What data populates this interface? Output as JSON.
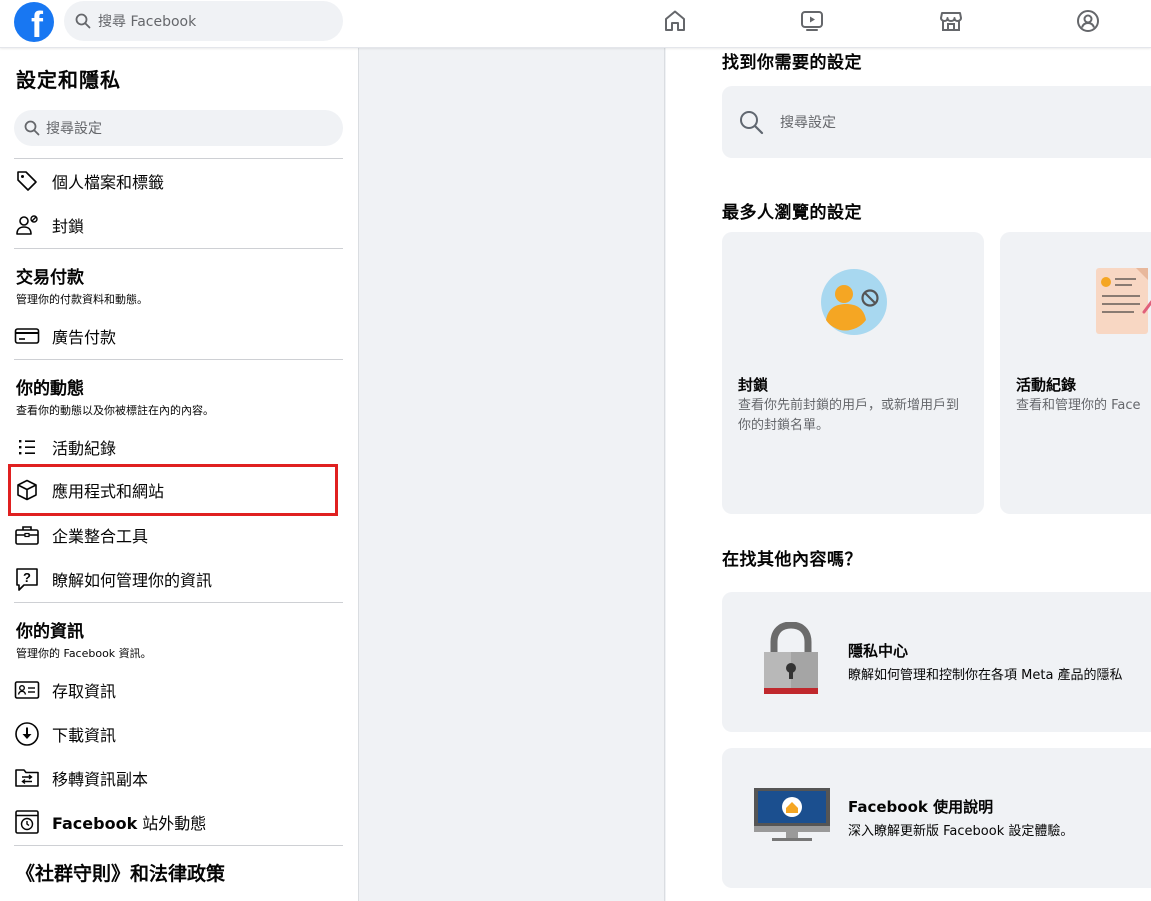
{
  "topbar": {
    "logo_letter": "f",
    "search_placeholder": "搜尋 Facebook"
  },
  "sidebar": {
    "title": "設定和隱私",
    "search_placeholder": "搜尋設定",
    "group1": [
      {
        "label": "個人檔案和標籤",
        "icon": "tag-icon"
      },
      {
        "label": "封鎖",
        "icon": "block-user-icon"
      }
    ],
    "payments": {
      "title": "交易付款",
      "subtitle": "管理你的付款資料和動態。",
      "items": [
        {
          "label": "廣告付款",
          "icon": "credit-card-icon"
        }
      ]
    },
    "activity": {
      "title": "你的動態",
      "subtitle": "查看你的動態以及你被標註在內的內容。",
      "items": [
        {
          "label": "活動紀錄",
          "icon": "list-icon"
        },
        {
          "label": "應用程式和網站",
          "icon": "cube-icon",
          "highlighted": true
        },
        {
          "label": "企業整合工具",
          "icon": "briefcase-icon"
        },
        {
          "label": "瞭解如何管理你的資訊",
          "icon": "question-icon"
        }
      ]
    },
    "info": {
      "title": "你的資訊",
      "subtitle": "管理你的 Facebook 資訊。",
      "items": [
        {
          "label": "存取資訊",
          "icon": "id-card-icon"
        },
        {
          "label": "下載資訊",
          "icon": "download-icon"
        },
        {
          "label": "移轉資訊副本",
          "icon": "folder-transfer-icon"
        },
        {
          "label": "站外動態",
          "label_prefix": "Facebook",
          "icon": "history-icon"
        }
      ]
    },
    "legal": {
      "title": "《社群守則》和法律政策"
    }
  },
  "main": {
    "find_heading": "找到你需要的設定",
    "search_placeholder": "搜尋設定",
    "popular_heading": "最多人瀏覽的設定",
    "cards": [
      {
        "title": "封鎖",
        "desc": "查看你先前封鎖的用戶，或新增用戶到你的封鎖名單。",
        "icon": "blocking-illustration-icon"
      },
      {
        "title": "活動紀錄",
        "desc": "查看和管理你的 Face",
        "icon": "activity-log-illustration-icon"
      }
    ],
    "other_heading": "在找其他內容嗎？",
    "links": [
      {
        "title": "隱私中心",
        "desc": "瞭解如何管理和控制你在各項 Meta 產品的隱私",
        "icon": "padlock-illustration-icon"
      },
      {
        "title": "Facebook 使用說明",
        "desc": "深入瞭解更新版 Facebook 設定體驗。",
        "icon": "monitor-home-illustration-icon"
      }
    ]
  },
  "colors": {
    "brand": "#1877f2",
    "highlight_border": "#e02020",
    "muted_text": "#65676b",
    "panel_bg": "#f0f2f5"
  }
}
